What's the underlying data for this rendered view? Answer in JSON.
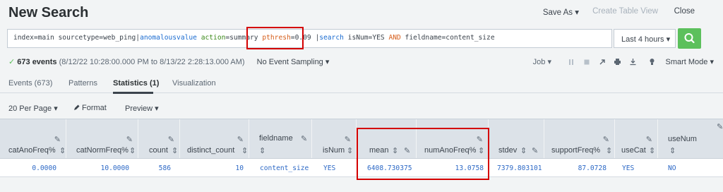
{
  "header": {
    "title": "New Search",
    "save_as": "Save As ▾",
    "create_table_view": "Create Table View",
    "close": "Close"
  },
  "search": {
    "parts": [
      {
        "text": "index=main sourcetype=web_ping|",
        "style": "plain"
      },
      {
        "text": "anomalousvalue",
        "style": "blue"
      },
      {
        "text": " action",
        "style": "green"
      },
      {
        "text": "=summary ",
        "style": "plain"
      },
      {
        "text": "pthresh",
        "style": "orange"
      },
      {
        "text": "=0.09 ",
        "style": "plain"
      },
      {
        "text": "|",
        "style": "plain"
      },
      {
        "text": "search",
        "style": "blue"
      },
      {
        "text": " isNum=YES ",
        "style": "plain"
      },
      {
        "text": "AND",
        "style": "orange"
      },
      {
        "text": " fieldname=content_size",
        "style": "plain"
      }
    ],
    "time_range": "Last 4 hours ▾"
  },
  "status": {
    "check": "✓",
    "events_count": "673 events",
    "time_span": "(8/12/22 10:28:00.000 PM to 8/13/22 2:28:13.000 AM)",
    "sampling": "No Event Sampling ▾",
    "job": "Job ▾",
    "smart_mode": "Smart Mode ▾"
  },
  "tabs": [
    {
      "label": "Events (673)"
    },
    {
      "label": "Patterns"
    },
    {
      "label": "Statistics (1)"
    },
    {
      "label": "Visualization"
    }
  ],
  "toolbar": {
    "per_page": "20 Per Page ▾",
    "format": "Format",
    "preview": "Preview ▾"
  },
  "table": {
    "columns": [
      {
        "label": "catAnoFreq%",
        "sort": "⇕"
      },
      {
        "label": "catNormFreq%",
        "sort": "⇕"
      },
      {
        "label": "count",
        "sort": "⇕"
      },
      {
        "label": "distinct_count",
        "sort": "⇕"
      },
      {
        "label": "fieldname",
        "sort": "⇕"
      },
      {
        "label": "isNum",
        "sort": "⇕"
      },
      {
        "label": "mean",
        "sort": "⇕"
      },
      {
        "label": "numAnoFreq%",
        "sort": "⇕"
      },
      {
        "label": "stdev",
        "sort": "⇕"
      },
      {
        "label": "supportFreq%",
        "sort": "⇕"
      },
      {
        "label": "useCat",
        "sort": "⇕"
      },
      {
        "label": "useNum",
        "sort": "⇕"
      }
    ],
    "row": [
      "0.0000",
      "10.0000",
      "586",
      "10",
      "content_size",
      "YES",
      "6408.730375",
      "13.0758",
      "7379.803101",
      "87.0728",
      "YES",
      "NO"
    ]
  },
  "icons": {
    "search": "search-icon",
    "pause": "pause-icon",
    "stop": "stop-icon",
    "share": "share-icon",
    "print": "print-icon",
    "export": "export-icon",
    "bulb": "bulb-icon",
    "pencil": "pencil-icon"
  },
  "colors": {
    "accent_green": "#5cc05c",
    "highlight_red": "#d40000",
    "link_blue": "#2d69c6"
  }
}
